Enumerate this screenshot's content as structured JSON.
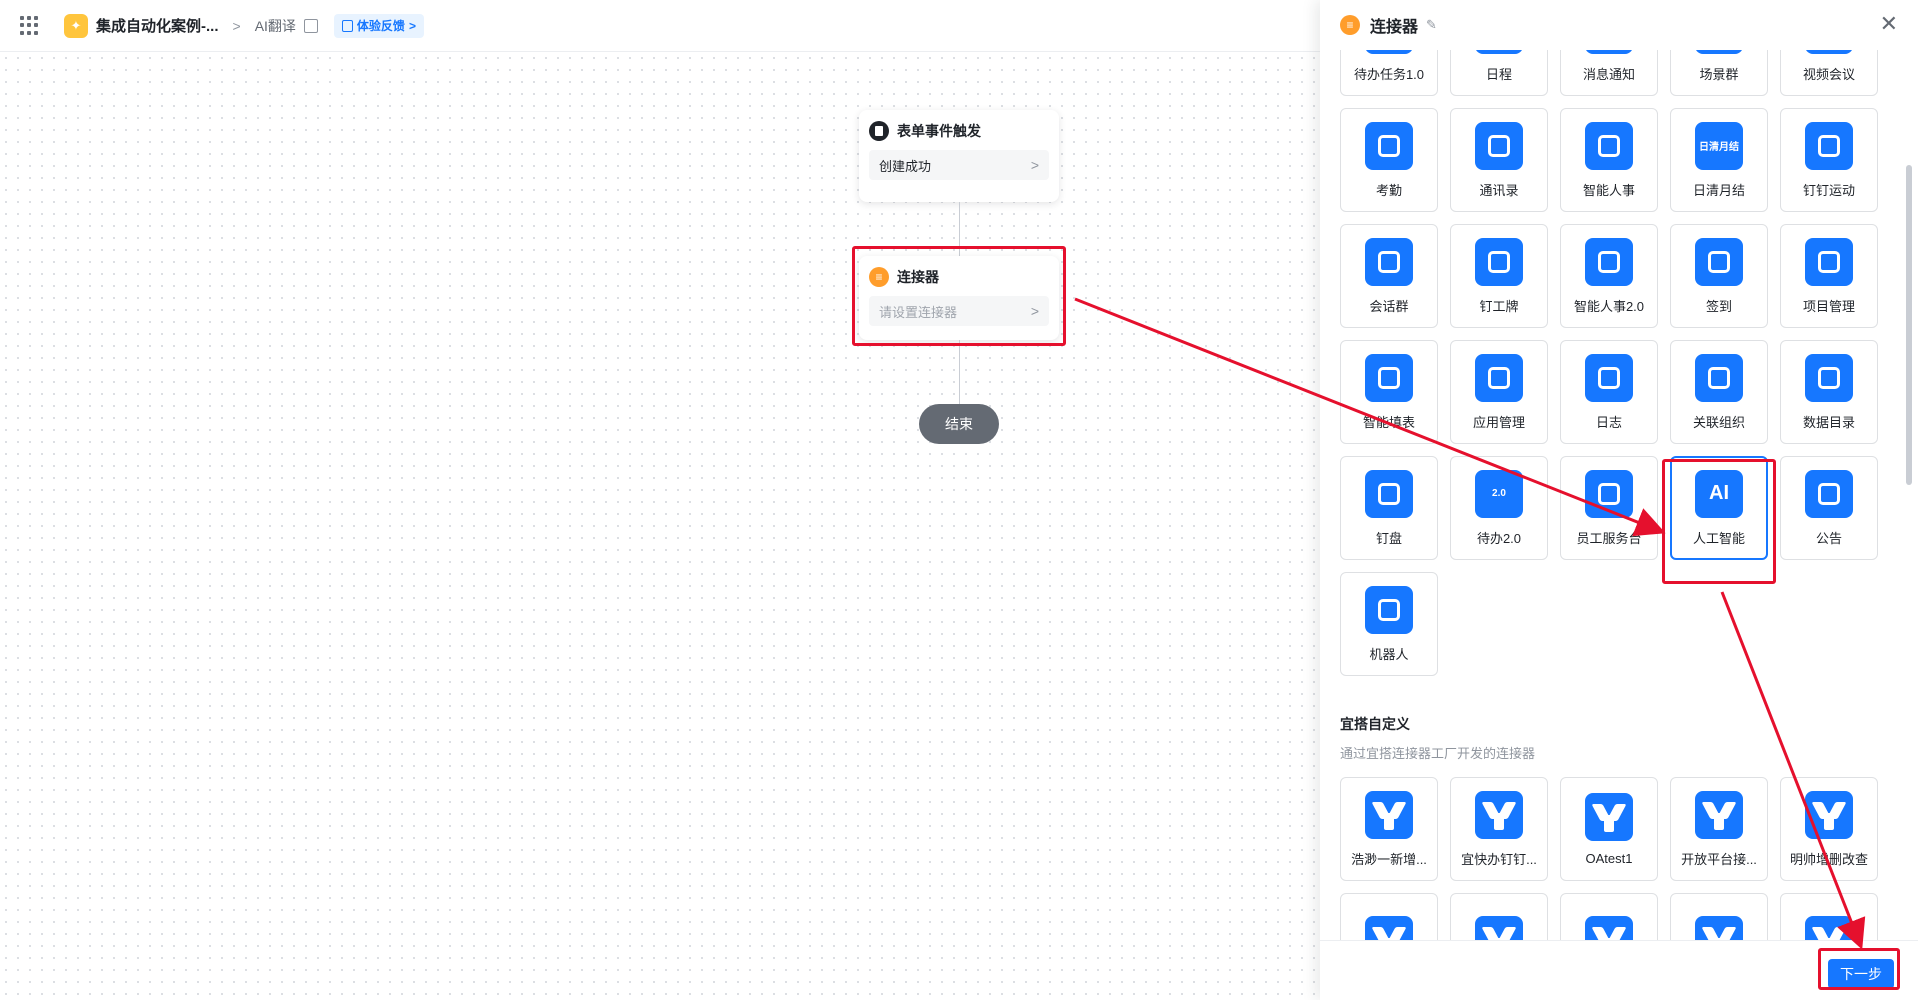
{
  "topbar": {
    "app_name": "集成自动化案例-...",
    "breadcrumb": "AI翻译",
    "feedback_label": "体验反馈"
  },
  "canvas": {
    "trigger_node": {
      "title": "表单事件触发",
      "value": "创建成功"
    },
    "connector_node": {
      "title": "连接器",
      "placeholder": "请设置连接器"
    },
    "end_node": {
      "label": "结束"
    }
  },
  "panel": {
    "title": "连接器",
    "official_rows": [
      [
        {
          "label": "待办任务1.0",
          "icon": "todo-icon"
        },
        {
          "label": "日程",
          "icon": "calendar-icon"
        },
        {
          "label": "消息通知",
          "icon": "message-icon"
        },
        {
          "label": "场景群",
          "icon": "group-icon"
        },
        {
          "label": "视频会议",
          "icon": "video-icon"
        }
      ],
      [
        {
          "label": "考勤",
          "icon": "attendance-icon"
        },
        {
          "label": "通讯录",
          "icon": "contacts-icon"
        },
        {
          "label": "智能人事",
          "icon": "hr-icon"
        },
        {
          "label": "日清月结",
          "icon": "daily-icon",
          "glyph": "日清月结"
        },
        {
          "label": "钉钉运动",
          "icon": "sport-icon"
        }
      ],
      [
        {
          "label": "会话群",
          "icon": "chat-group-icon"
        },
        {
          "label": "钉工牌",
          "icon": "badge-icon"
        },
        {
          "label": "智能人事2.0",
          "icon": "hr2-icon"
        },
        {
          "label": "签到",
          "icon": "checkin-icon"
        },
        {
          "label": "项目管理",
          "icon": "folder-icon"
        }
      ],
      [
        {
          "label": "智能填表",
          "icon": "form-fill-icon"
        },
        {
          "label": "应用管理",
          "icon": "apps-icon"
        },
        {
          "label": "日志",
          "icon": "log-icon"
        },
        {
          "label": "关联组织",
          "icon": "org-icon"
        },
        {
          "label": "数据目录",
          "icon": "data-catalog-icon"
        }
      ],
      [
        {
          "label": "钉盘",
          "icon": "cloud-drive-icon"
        },
        {
          "label": "待办2.0",
          "icon": "todo2-icon",
          "glyph": "2.0"
        },
        {
          "label": "员工服务台",
          "icon": "service-desk-icon"
        },
        {
          "label": "人工智能",
          "icon": "ai-icon",
          "glyph": "AI"
        },
        {
          "label": "公告",
          "icon": "announcement-icon"
        }
      ],
      [
        {
          "label": "机器人",
          "icon": "robot-icon"
        }
      ]
    ],
    "custom_section": {
      "title": "宜搭自定义",
      "subtitle": "通过宜搭连接器工厂开发的连接器",
      "items": [
        {
          "label": "浩渺一新增..."
        },
        {
          "label": "宜快办钉钉..."
        },
        {
          "label": "OAtest1"
        },
        {
          "label": "开放平台接..."
        },
        {
          "label": "明帅增删改查"
        }
      ]
    },
    "next_label": "下一步"
  },
  "colors": {
    "accent": "#1677ff",
    "annotation": "#e5102d",
    "connector_orange": "#ff9d2b"
  }
}
